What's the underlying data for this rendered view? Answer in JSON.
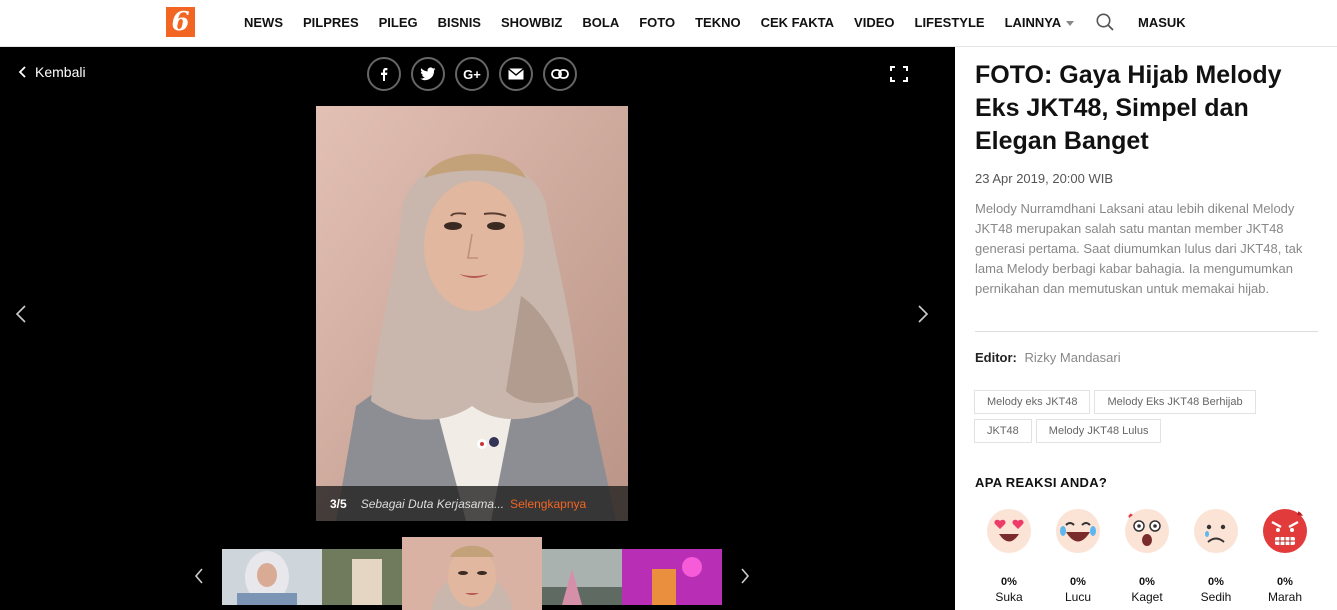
{
  "header": {
    "logo": "6",
    "nav": [
      "NEWS",
      "PILPRES",
      "PILEG",
      "BISNIS",
      "SHOWBIZ",
      "BOLA",
      "FOTO",
      "TEKNO",
      "CEK FAKTA",
      "VIDEO",
      "LIFESTYLE",
      "LAINNYA"
    ],
    "login": "MASUK",
    "search_icon": "search-icon"
  },
  "gallery": {
    "back_label": "Kembali",
    "share_icons": [
      "facebook-icon",
      "twitter-icon",
      "google-plus-icon",
      "email-icon",
      "link-icon"
    ],
    "share_gplus": "G+",
    "counter": "3/5",
    "caption": "Sebagai Duta Kerjasama...",
    "caption_more": "Selengkapnya"
  },
  "article": {
    "title": "FOTO: Gaya Hijab Melody Eks JKT48, Simpel dan Elegan Banget",
    "date": "23 Apr 2019, 20:00 WIB",
    "description": "Melody Nurramdhani Laksani atau lebih dikenal Melody JKT48 merupakan salah satu mantan member JKT48 generasi pertama. Saat diumumkan lulus dari JKT48, tak lama Melody berbagi kabar bahagia. Ia mengumumkan pernikahan dan memutuskan untuk memakai hijab.",
    "editor_label": "Editor:",
    "editor_name": "Rizky Mandasari",
    "tags": [
      "Melody eks JKT48",
      "Melody Eks JKT48 Berhijab",
      "JKT48",
      "Melody JKT48 Lulus"
    ],
    "reactions_title": "APA REAKSI ANDA?",
    "reactions": [
      {
        "label": "Suka",
        "percent": "0%",
        "icon": "love-eyes-emoji-icon"
      },
      {
        "label": "Lucu",
        "percent": "0%",
        "icon": "laughing-emoji-icon"
      },
      {
        "label": "Kaget",
        "percent": "0%",
        "icon": "shocked-emoji-icon"
      },
      {
        "label": "Sedih",
        "percent": "0%",
        "icon": "sad-emoji-icon"
      },
      {
        "label": "Marah",
        "percent": "0%",
        "icon": "angry-emoji-icon"
      }
    ]
  },
  "colors": {
    "brand": "#f26522",
    "gallery_bg": "#000000"
  }
}
